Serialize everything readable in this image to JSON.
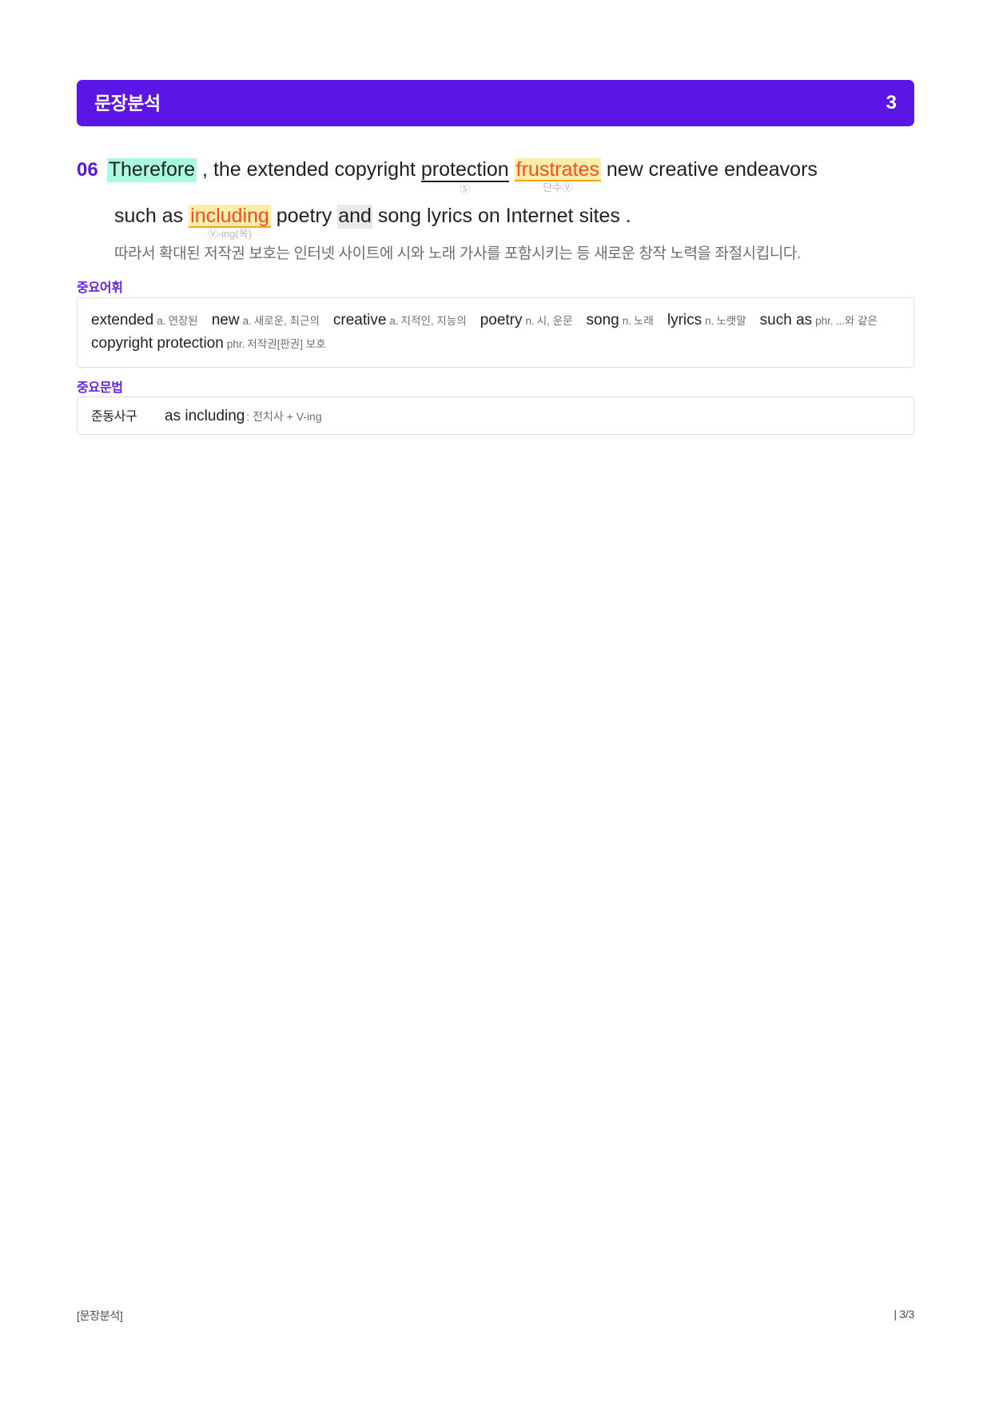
{
  "header": {
    "title": "문장분석",
    "page_number": "3",
    "bar_color": "#5b16e6"
  },
  "sentence": {
    "number": "06",
    "line1": {
      "tokens": [
        {
          "text": "Therefore",
          "style": "hl-mint"
        },
        {
          "text": ",",
          "style": "plain"
        },
        {
          "text": "the",
          "style": "plain"
        },
        {
          "text": "extended",
          "style": "plain"
        },
        {
          "text": "copyright",
          "style": "plain"
        },
        {
          "text": "protection",
          "style": "u-black",
          "annotation": "Ⓢ"
        },
        {
          "text": "frustrates",
          "style": "hl-yellow-orange",
          "annotation": "단수Ⓥ"
        },
        {
          "text": "new",
          "style": "plain"
        },
        {
          "text": "creative",
          "style": "plain"
        },
        {
          "text": "endeavors",
          "style": "plain"
        }
      ]
    },
    "line2": {
      "tokens": [
        {
          "text": "such",
          "style": "plain"
        },
        {
          "text": "as",
          "style": "plain"
        },
        {
          "text": "including",
          "style": "hl-yellow-orange",
          "annotation": "Ⓥ-ing(목)"
        },
        {
          "text": "poetry",
          "style": "plain"
        },
        {
          "text": "and",
          "style": "hl-gray"
        },
        {
          "text": "song",
          "style": "plain"
        },
        {
          "text": "lyrics",
          "style": "plain"
        },
        {
          "text": "on",
          "style": "plain"
        },
        {
          "text": "Internet",
          "style": "plain"
        },
        {
          "text": "sites",
          "style": "plain"
        },
        {
          "text": ".",
          "style": "plain"
        }
      ]
    },
    "translation": "따라서 확대된 저작권 보호는 인터넷 사이트에 시와 노래 가사를 포함시키는 등 새로운 창작 노력을 좌절시킵니다."
  },
  "vocabulary": {
    "label": "중요어휘",
    "entries": [
      {
        "term": "extended",
        "pos": "a.",
        "definition": "연장된"
      },
      {
        "term": "new",
        "pos": "a.",
        "definition": "새로운, 최근의"
      },
      {
        "term": "creative",
        "pos": "a.",
        "definition": "지적인, 지능의"
      },
      {
        "term": "poetry",
        "pos": "n.",
        "definition": "시, 운문"
      },
      {
        "term": "song",
        "pos": "n.",
        "definition": "노래"
      },
      {
        "term": "lyrics",
        "pos": "n.",
        "definition": "노랫말"
      },
      {
        "term": "such as",
        "pos": "phr.",
        "definition": "...와 같은"
      },
      {
        "term": "copyright protection",
        "pos": "phr.",
        "definition": "저작권[판권] 보호"
      }
    ]
  },
  "grammar": {
    "label": "중요문법",
    "entries": [
      {
        "tag": "준동사구",
        "term": "as including",
        "description": ": 전치사 + V-ing"
      }
    ]
  },
  "footer": {
    "left": "[문장분석]",
    "right": "| 3/3"
  },
  "colors": {
    "accent_purple": "#5b16e6",
    "label_purple": "#6a24e0",
    "highlight_mint": "#a9fbe0",
    "highlight_yellow": "#ffeeab",
    "highlight_gray": "#e9e9e9",
    "text_orange": "#f44d20",
    "underline_orange": "#f6a21d",
    "muted_gray": "#6d6d6d"
  }
}
